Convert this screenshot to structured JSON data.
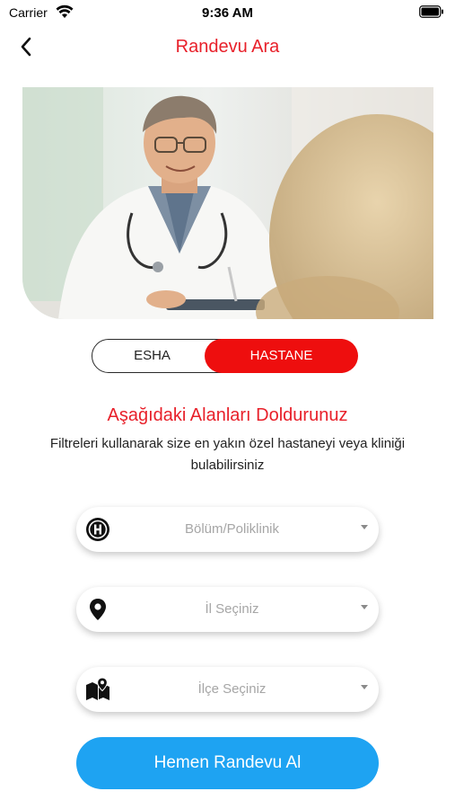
{
  "status_bar": {
    "carrier": "Carrier",
    "time": "9:36 AM"
  },
  "nav": {
    "title": "Randevu Ara"
  },
  "segmented": {
    "left_label": "ESHA",
    "right_label": "HASTANE",
    "selected": "HASTANE"
  },
  "form": {
    "heading": "Aşağıdaki Alanları Doldurunuz",
    "description": "Filtreleri kullanarak size en yakın özel hastaneyi veya kliniği bulabilirsiniz",
    "fields": [
      {
        "placeholder": "Bölüm/Poliklinik",
        "icon": "hospital-icon"
      },
      {
        "placeholder": "İl Seçiniz",
        "icon": "location-pin-icon"
      },
      {
        "placeholder": "İlçe Seçiniz",
        "icon": "map-pin-icon"
      }
    ]
  },
  "cta": {
    "label": "Hemen Randevu Al"
  },
  "colors": {
    "brand_red": "#e8202a",
    "toggle_red": "#ee0e0e",
    "cta_blue": "#1ea3f2"
  }
}
